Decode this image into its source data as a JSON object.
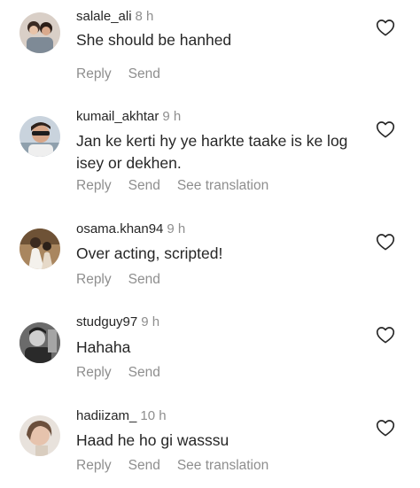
{
  "comments": [
    {
      "username": "salale_ali",
      "time": "8 h",
      "text": "She should be hanhed",
      "reply_label": "Reply",
      "send_label": "Send"
    },
    {
      "username": "kumail_akhtar",
      "time": "9 h",
      "text": "Jan ke kerti hy ye harkte taake is ke log isey or dekhen.",
      "reply_label": "Reply",
      "send_label": "Send",
      "translation_label": "See translation"
    },
    {
      "username": "osama.khan94",
      "time": "9 h",
      "text": "Over acting, scripted!",
      "reply_label": "Reply",
      "send_label": "Send"
    },
    {
      "username": "studguy97",
      "time": "9 h",
      "text": "Hahaha",
      "reply_label": "Reply",
      "send_label": "Send"
    },
    {
      "username": "hadiizam_",
      "time": "10 h",
      "text": "Haad he ho gi wasssu",
      "reply_label": "Reply",
      "send_label": "Send",
      "translation_label": "See translation"
    }
  ],
  "icons": {
    "like": "heart-outline-icon"
  },
  "colors": {
    "primary_text": "#262626",
    "secondary_text": "#8e8e8e"
  }
}
